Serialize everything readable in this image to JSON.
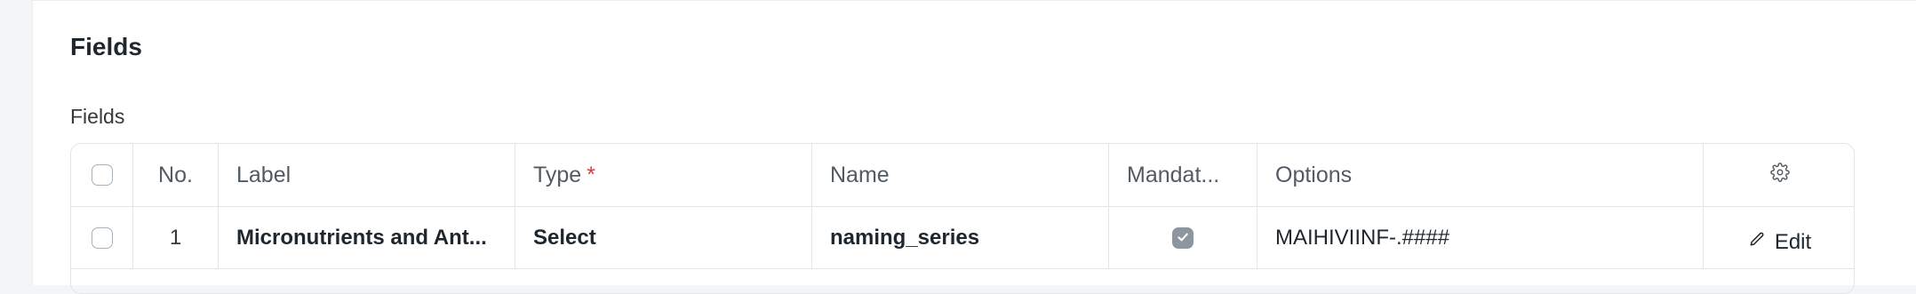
{
  "section": {
    "title": "Fields"
  },
  "table": {
    "field_label": "Fields",
    "columns": {
      "no": "No.",
      "label": "Label",
      "type": "Type",
      "type_required_mark": "*",
      "name": "Name",
      "mandatory": "Mandat...",
      "options": "Options"
    },
    "rows": [
      {
        "no": "1",
        "label": "Micronutrients and Ant...",
        "type": "Select",
        "name": "naming_series",
        "mandatory": true,
        "options": "MAIHIVIINF-.####",
        "edit_label": "Edit"
      }
    ]
  },
  "colors": {
    "required": "#e03636",
    "checked": "#8d969e"
  },
  "icons": {
    "settings": "gear-icon",
    "edit": "pencil-icon",
    "check": "check-icon"
  }
}
